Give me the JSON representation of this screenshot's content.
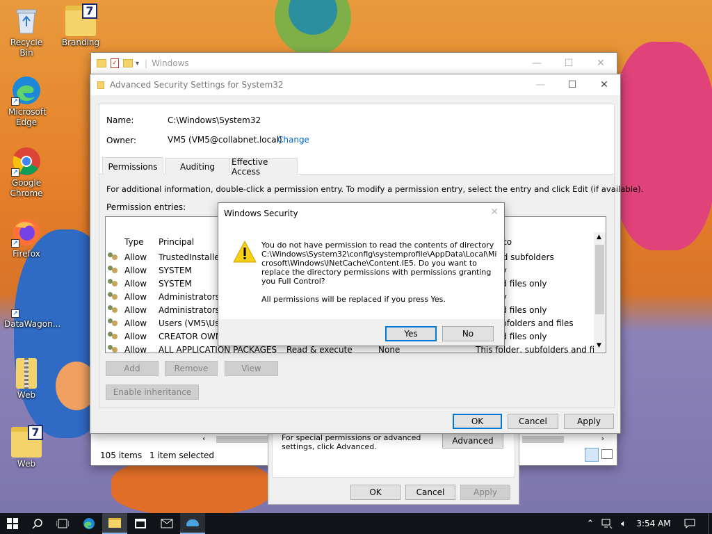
{
  "desktop": {
    "icons": [
      {
        "label": "Recycle Bin"
      },
      {
        "label": "Branding"
      },
      {
        "label": "Microsoft Edge"
      },
      {
        "label": "Google Chrome"
      },
      {
        "label": "Firefox"
      },
      {
        "label": "DataWagon..."
      },
      {
        "label": "Web"
      },
      {
        "label": "Web"
      }
    ]
  },
  "explorer": {
    "title": "Windows",
    "status_items": "105 items",
    "status_selected": "1 item selected"
  },
  "properties_dialog": {
    "text": "For special permissions or advanced settings, click Advanced.",
    "advanced_label": "Advanced",
    "ok_label": "OK",
    "cancel_label": "Cancel",
    "apply_label": "Apply"
  },
  "advanced_security": {
    "title": "Advanced Security Settings for System32",
    "name_label": "Name:",
    "name_value": "C:\\Windows\\System32",
    "owner_label": "Owner:",
    "owner_value": "VM5 (VM5@collabnet.local)",
    "change_label": "Change",
    "tabs": [
      "Permissions",
      "Auditing",
      "Effective Access"
    ],
    "info_text": "For additional information, double-click a permission entry. To modify a permission entry, select the entry and click Edit (if available).",
    "entries_label": "Permission entries:",
    "columns": {
      "type": "Type",
      "principal": "Principal",
      "applies": "to"
    },
    "rows": [
      {
        "type": "Allow",
        "principal": "TrustedInstaller",
        "access": "",
        "inherited": "",
        "applies": "der and subfolders"
      },
      {
        "type": "Allow",
        "principal": "SYSTEM",
        "access": "",
        "inherited": "",
        "applies": "ler only"
      },
      {
        "type": "Allow",
        "principal": "SYSTEM",
        "access": "",
        "inherited": "",
        "applies": "ers and files only"
      },
      {
        "type": "Allow",
        "principal": "Administrators (",
        "access": "",
        "inherited": "",
        "applies": "ler only"
      },
      {
        "type": "Allow",
        "principal": "Administrators (",
        "access": "",
        "inherited": "",
        "applies": "ers and files only"
      },
      {
        "type": "Allow",
        "principal": "Users (VM5\\User",
        "access": "",
        "inherited": "",
        "applies": "ler, subfolders and files"
      },
      {
        "type": "Allow",
        "principal": "CREATOR OWNE",
        "access": "",
        "inherited": "",
        "applies": "ers and files only"
      },
      {
        "type": "Allow",
        "principal": "ALL APPLICATION PACKAGES",
        "access": "Read & execute",
        "inherited": "None",
        "applies": "This folder, subfolders and files"
      }
    ],
    "add_label": "Add",
    "remove_label": "Remove",
    "view_label": "View",
    "enable_inheritance_label": "Enable inheritance",
    "ok_label": "OK",
    "cancel_label": "Cancel",
    "apply_label": "Apply"
  },
  "security_dialog": {
    "title": "Windows Security",
    "message_lines": [
      "You do not have permission to read the contents of directory",
      "C:\\Windows\\System32\\config\\systemprofile\\AppData\\Local\\Mi",
      "crosoft\\Windows\\INetCache\\Content.IE5. Do you want to",
      "replace the directory permissions with permissions granting",
      "you Full Control?"
    ],
    "note": "All permissions will be replaced if you press Yes.",
    "yes_label": "Yes",
    "no_label": "No"
  },
  "taskbar": {
    "time": "3:54 AM"
  },
  "colors": {
    "accent": "#0078d7",
    "link": "#0066cc",
    "taskbar": "#101418"
  }
}
